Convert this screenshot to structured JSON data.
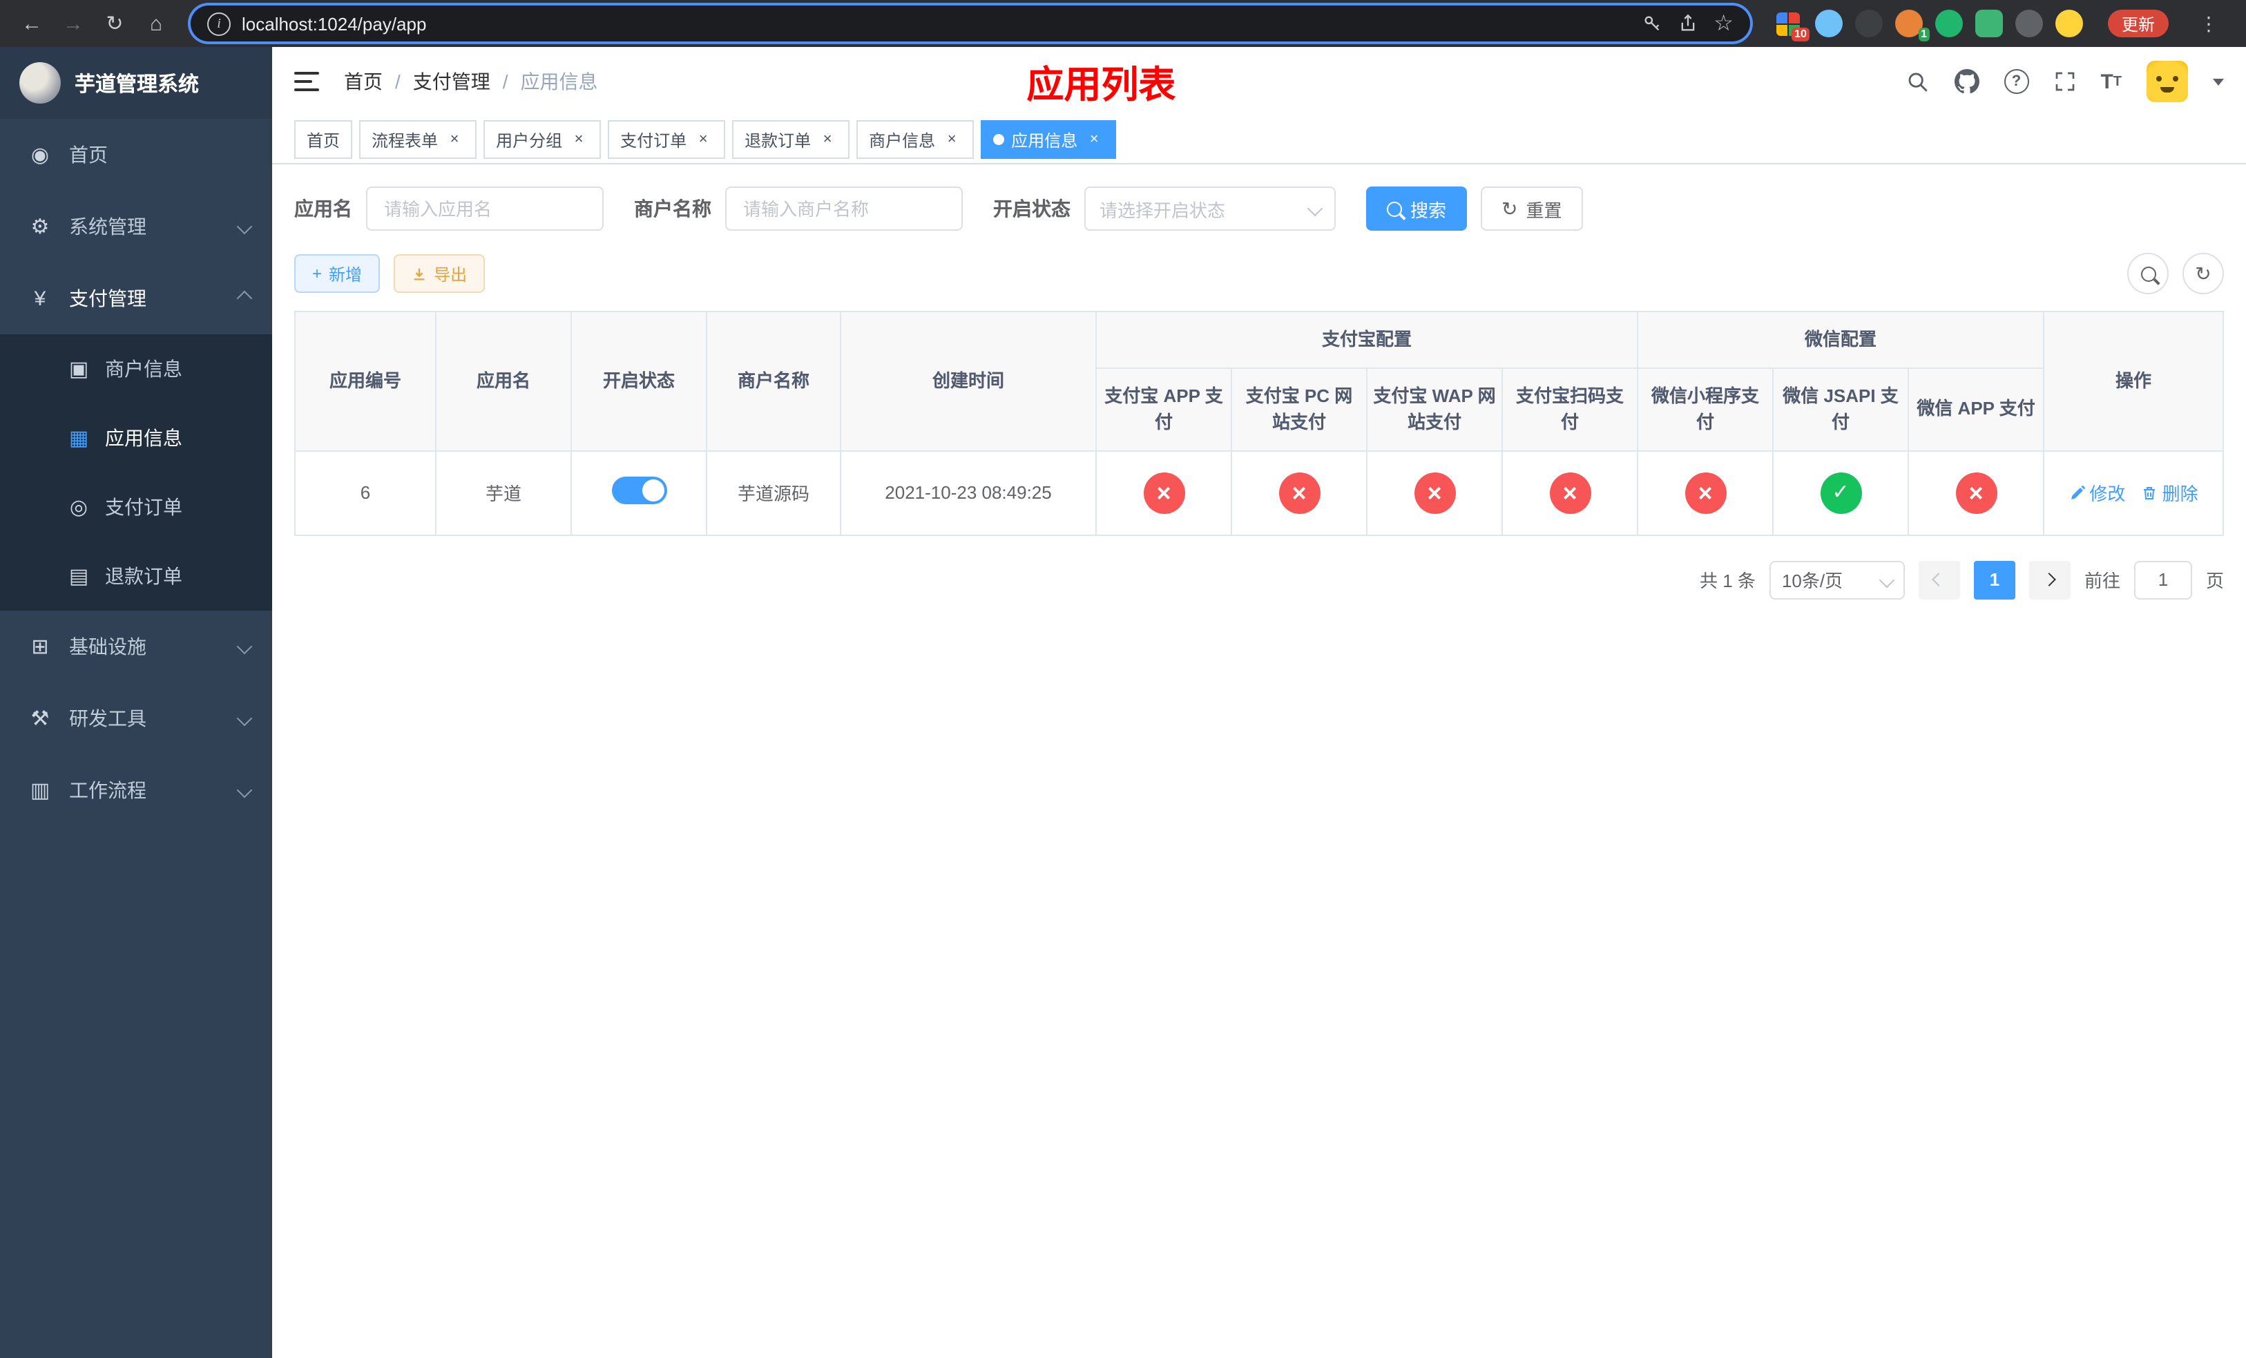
{
  "browser": {
    "url": "localhost:1024/pay/app",
    "update_button": "更新",
    "ext_badge_1": "10",
    "ext_badge_2": "1"
  },
  "sidebar": {
    "title": "芋道管理系统",
    "items": [
      {
        "label": "首页"
      },
      {
        "label": "系统管理"
      },
      {
        "label": "支付管理"
      },
      {
        "label": "商户信息"
      },
      {
        "label": "应用信息"
      },
      {
        "label": "支付订单"
      },
      {
        "label": "退款订单"
      },
      {
        "label": "基础设施"
      },
      {
        "label": "研发工具"
      },
      {
        "label": "工作流程"
      }
    ]
  },
  "header": {
    "breadcrumb": [
      "首页",
      "支付管理",
      "应用信息"
    ],
    "breadcrumb_separator": "/",
    "banner": "应用列表"
  },
  "tabs": [
    {
      "label": "首页"
    },
    {
      "label": "流程表单"
    },
    {
      "label": "用户分组"
    },
    {
      "label": "支付订单"
    },
    {
      "label": "退款订单"
    },
    {
      "label": "商户信息"
    },
    {
      "label": "应用信息"
    }
  ],
  "filters": {
    "app_name_label": "应用名",
    "app_name_placeholder": "请输入应用名",
    "merchant_label": "商户名称",
    "merchant_placeholder": "请输入商户名称",
    "status_label": "开启状态",
    "status_placeholder": "请选择开启状态",
    "search_button": "搜索",
    "reset_button": "重置"
  },
  "toolbar": {
    "add_button": "新增",
    "export_button": "导出"
  },
  "table": {
    "headers": {
      "app_id": "应用编号",
      "app_name": "应用名",
      "status": "开启状态",
      "merchant": "商户名称",
      "created": "创建时间",
      "alipay_group": "支付宝配置",
      "wechat_group": "微信配置",
      "ops": "操作",
      "alipay_app": "支付宝 APP 支付",
      "alipay_pc": "支付宝 PC 网站支付",
      "alipay_wap": "支付宝 WAP 网站支付",
      "alipay_qr": "支付宝扫码支付",
      "wx_lite": "微信小程序支付",
      "wx_jsapi": "微信 JSAPI 支付",
      "wx_app": "微信 APP 支付"
    },
    "row": {
      "app_id": "6",
      "app_name": "芋道",
      "merchant": "芋道源码",
      "created": "2021-10-23 08:49:25",
      "configs": [
        {
          "name": "alipay-app",
          "state": "fail"
        },
        {
          "name": "alipay-pc",
          "state": "fail"
        },
        {
          "name": "alipay-wap",
          "state": "fail"
        },
        {
          "name": "alipay-qr",
          "state": "fail"
        },
        {
          "name": "wx-lite",
          "state": "fail"
        },
        {
          "name": "wx-jsapi",
          "state": "pass"
        },
        {
          "name": "wx-app",
          "state": "fail"
        }
      ],
      "edit": "修改",
      "delete": "删除"
    }
  },
  "pagination": {
    "total": "共 1 条",
    "page_size": "10条/页",
    "current_page": "1",
    "goto_label": "前往",
    "goto_value": "1",
    "goto_suffix": "页"
  },
  "colors": {
    "accent": "#409EFF",
    "fail": "#f85656",
    "pass": "#17c15c",
    "banner": "#ff0000",
    "sidebar_bg": "#304156",
    "submenu_bg": "#1f2d3d"
  }
}
